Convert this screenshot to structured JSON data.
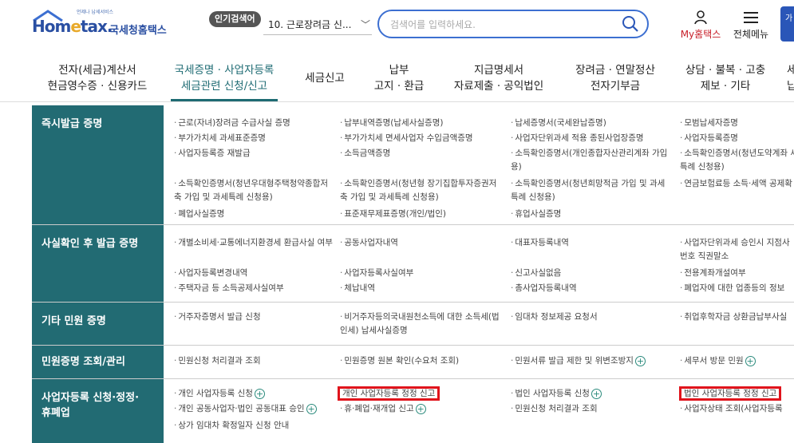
{
  "header": {
    "logo_sub": "언제나 납세서비스",
    "logo_main_pre": "Hom",
    "logo_main_e": "e",
    "logo_main_post": "tax.",
    "logo_kr": "국세청홈택스",
    "hot_label": "인기검색어",
    "hot_value": "10. 근로장려금 신...",
    "search_placeholder": "검색어를 입력하세요.",
    "my_label": "My홈택스",
    "menu_label": "전체메뉴",
    "side_btn": "가"
  },
  "gnb": [
    {
      "line1": "전자(세금)계산서",
      "line2": "현금영수증 · 신용카드"
    },
    {
      "line1": "국세증명 · 사업자등록",
      "line2": "세금관련 신청/신고"
    },
    {
      "line1": "세금신고",
      "line2": ""
    },
    {
      "line1": "납부",
      "line2": "고지 · 환급"
    },
    {
      "line1": "지급명세서",
      "line2": "자료제출 · 공익법인"
    },
    {
      "line1": "장려금 · 연말정산",
      "line2": "전자기부금"
    },
    {
      "line1": "상담 · 불복 · 고충",
      "line2": "제보 · 기타"
    },
    {
      "line1": "세",
      "line2": "납"
    }
  ],
  "rows": [
    {
      "head": "즉시발급 증명",
      "items": [
        [
          "근로(자녀)장려금 수급사실 증명",
          "납부내역증명(납세사실증명)",
          "납세증명서(국세완납증명)",
          "모범납세자증명"
        ],
        [
          "부가가치세 과세표준증명",
          "부가가치세 면세사업자 수입금액증명",
          "사업자단위과세 적용 종된사업장증명",
          "사업자등록증명"
        ],
        [
          "사업자등록증 재발급",
          "소득금액증명",
          "소득확인증명서(개인종합자산관리계좌 가입용)",
          "소득확인증명서(청년도약계좌 세특례 신청용)"
        ],
        [
          "소득확인증명서(청년우대형주택청약종합저축 가입 및 과세특례 신청용)",
          "소득확인증명서(청년형 장기집합투자증권저축 가입 및 과세특례 신청용)",
          "소득확인증명서(청년희망적금 가입 및 과세특례 신청용)",
          "연금보험료등 소득·세액 공제확"
        ],
        [
          "폐업사실증명",
          "표준재무제표증명(개인/법인)",
          "휴업사실증명",
          ""
        ]
      ]
    },
    {
      "head": "사실확인 후 발급 증명",
      "items": [
        [
          "개별소비세·교통에너지환경세 환급사실 여부",
          "공동사업자내역",
          "대표자등록내역",
          "사업자단위과세 승인시 지점사 번호 직권말소"
        ],
        [
          "사업자등록변경내역",
          "사업자등록사실여부",
          "신고사실없음",
          "전용계좌개설여부"
        ],
        [
          "주택자금 등 소득공제사실여부",
          "체납내역",
          "총사업자등록내역",
          "폐업자에 대한 업종등의 정보"
        ]
      ]
    },
    {
      "head": "기타 민원 증명",
      "items": [
        [
          "거주자증명서 발급 신청",
          "비거주자등의국내원천소득에 대한 소득세(법인세) 납세사실증명",
          "임대차 정보제공 요청서",
          "취업후학자금 상환금납부사실"
        ]
      ]
    },
    {
      "head": "민원증명 조회/관리",
      "items": [
        [
          "민원신청 처리결과 조회",
          "민원증명 원본 확인(수요처 조회)",
          "민원서류 발급 제한 및 위변조방지",
          "세무서 방문 민원"
        ]
      ]
    },
    {
      "head_line1": "사업자등록 신청·정정·",
      "head_line2": "휴폐업",
      "items": [
        [
          "개인 사업자등록 신청",
          "개인 사업자등록 정정 신고",
          "법인 사업자등록 신청",
          "법인 사업자등록 정정 신고"
        ],
        [
          "개인 공동사업자·법인 공동대표 승인",
          "휴·폐업·재개업 신고",
          "민원신청 처리결과 조회",
          "사업자상태 조회(사업자등록"
        ],
        [
          "상가 임대차 확정일자 신청 안내",
          "",
          "",
          ""
        ]
      ]
    }
  ]
}
